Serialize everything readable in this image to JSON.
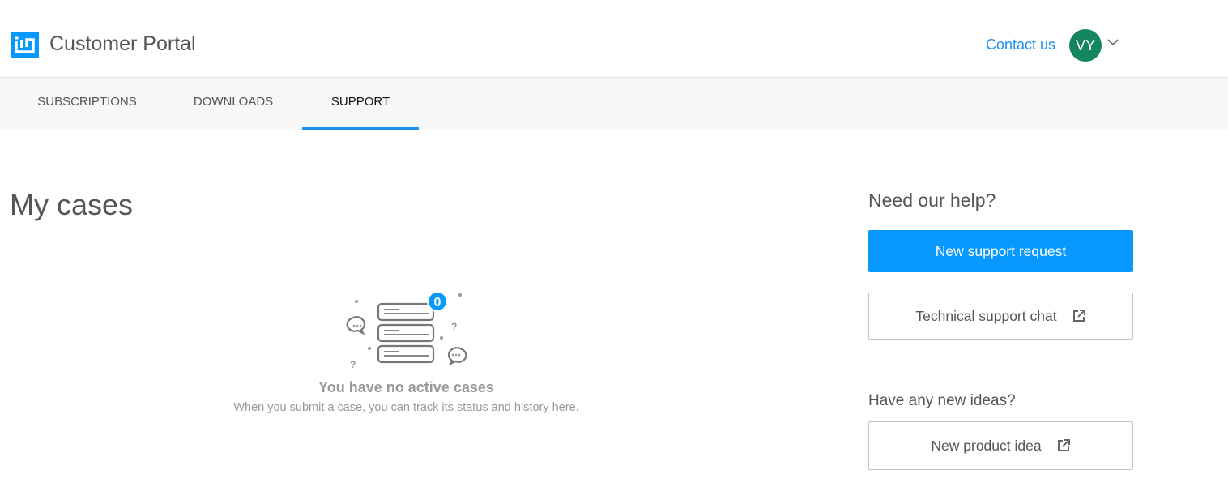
{
  "header": {
    "brand": "Customer Portal",
    "contact": "Contact us",
    "avatar_initials": "VY",
    "avatar_color": "#13865f",
    "accent": "#0899fe"
  },
  "nav": {
    "tabs": [
      {
        "label": "SUBSCRIPTIONS"
      },
      {
        "label": "DOWNLOADS"
      },
      {
        "label": "SUPPORT",
        "active": true
      }
    ]
  },
  "main": {
    "title": "My cases",
    "empty_badge": "0",
    "empty_title": "You have no active cases",
    "empty_subtitle": "When you submit a case, you can track its status and history here."
  },
  "sidebar": {
    "help_heading": "Need our help?",
    "new_request": "New support request",
    "chat": "Technical support chat",
    "ideas_heading": "Have any new ideas?",
    "new_idea": "New product idea"
  }
}
